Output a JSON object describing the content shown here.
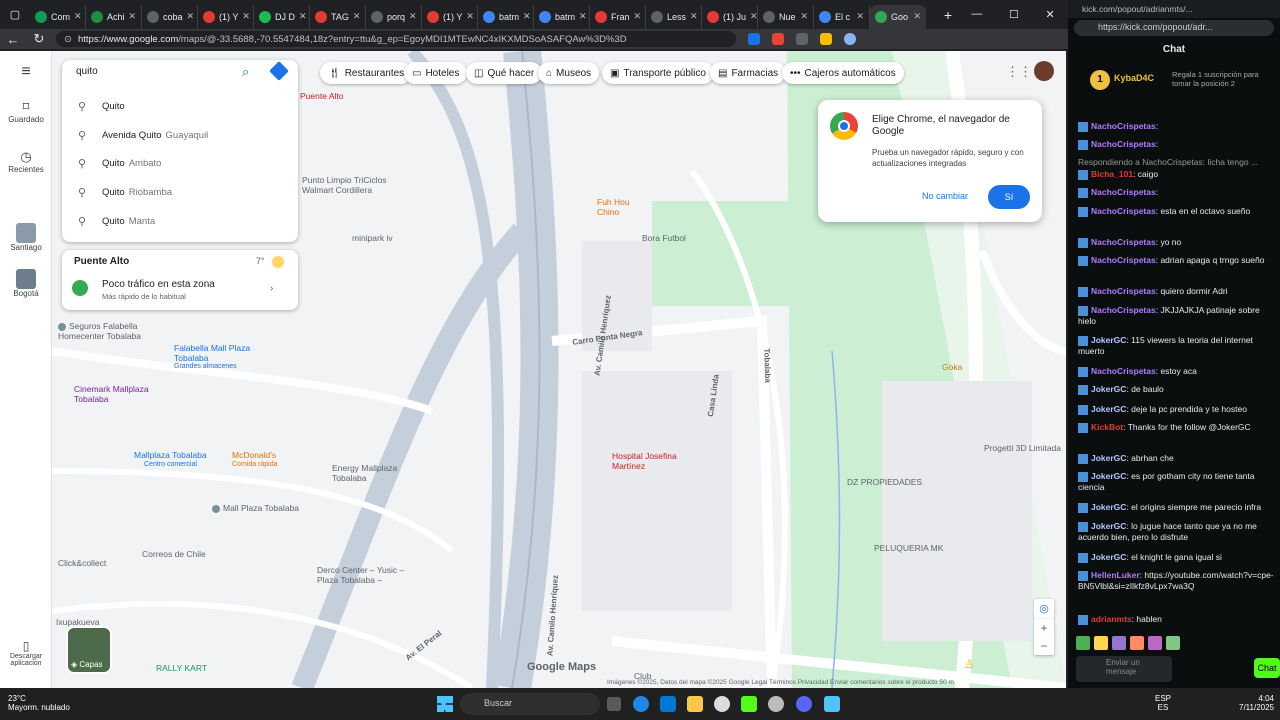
{
  "browser": {
    "tabs": [
      {
        "label": "Com",
        "color": "#0f9d58"
      },
      {
        "label": "Achi",
        "color": "#1e8e3e"
      },
      {
        "label": "coba",
        "color": "#5f6368"
      },
      {
        "label": "(1) Y",
        "color": "#e53935"
      },
      {
        "label": "DJ D",
        "color": "#1db954"
      },
      {
        "label": "TAG",
        "color": "#e53935"
      },
      {
        "label": "porq",
        "color": "#5f6368"
      },
      {
        "label": "(1) Y",
        "color": "#e53935"
      },
      {
        "label": "batm",
        "color": "#4285f4"
      },
      {
        "label": "batm",
        "color": "#4285f4"
      },
      {
        "label": "Fran",
        "color": "#e53935"
      },
      {
        "label": "Less",
        "color": "#5f6368"
      },
      {
        "label": "(1) Ju",
        "color": "#e53935"
      },
      {
        "label": "Nue",
        "color": "#5f6368"
      },
      {
        "label": "El c",
        "color": "#4285f4"
      },
      {
        "label": "Goo",
        "color": "#34a853"
      }
    ],
    "url_host": "https://www.google.com",
    "url_path": "/maps/@-33.5688,-70.5547484,18z?entry=ttu&g_ep=EgoyMDI1MTEwNC4xIKXMDSoASAFQAw%3D%3D"
  },
  "maps": {
    "rail": {
      "menu_icon": "menu-icon",
      "saved": "Guardado",
      "recent": "Recientes",
      "place1": "Santiago",
      "place2": "Bogotá",
      "download": "Descargar aplicación"
    },
    "search": {
      "value": "quito"
    },
    "suggestions": [
      {
        "main": "Quito",
        "sub": ""
      },
      {
        "main": "Avenida Quito",
        "sub": "Guayaquil"
      },
      {
        "main": "Quito",
        "sub": "Ambato"
      },
      {
        "main": "Quito",
        "sub": "Riobamba"
      },
      {
        "main": "Quito",
        "sub": "Manta"
      }
    ],
    "weather": {
      "place": "Puente Alto",
      "temp": "7°",
      "traffic": "Poco tráfico en esta zona",
      "traffic_sub": "Más rápido de lo habitual"
    },
    "chips": [
      "Restaurantes",
      "Hoteles",
      "Qué hacer",
      "Museos",
      "Transporte público",
      "Farmacias",
      "Cajeros automáticos"
    ],
    "popup": {
      "title": "Elige Chrome, el navegador de Google",
      "body": "Prueba un navegador rápido, seguro y con actualizaciones integradas",
      "decline": "No cambiar",
      "accept": "Sí"
    },
    "layers": "Capas",
    "brand": "Google Maps",
    "footer": "Imágenes ©2025, Datos del mapa ©2025 Google   Legal   Términos   Privacidad   Enviar comentarios sobre el producto   50 m",
    "pois": {
      "puente_alto": "Puente Alto",
      "triciclos": "Punto Limpio TriCiclos Walmart Cordillera",
      "minipark": "minipark iv",
      "fuhou": "Fuh Hou",
      "fuhou_sub": "Chino",
      "bora": "Bora Futbol",
      "falabella": "Seguros Falabella Homecenter Tobalaba",
      "falabella_mall": "Falabella Mall Plaza Tobalaba",
      "grandes": "Grandes almacenes",
      "cinemark": "Cinemark Mallplaza Tobalaba",
      "mallplaza": "Mallplaza Tobalaba",
      "centro_comercial": "Centro comercial",
      "mcd": "McDonald's",
      "comida": "Comida rápida",
      "energy": "Energy Mallplaza Tobalaba",
      "mall_plaza": "Mall Plaza Tobalaba",
      "correos": "Correos de Chile",
      "clickcollect": "Click&collect",
      "derco": "Derco Center – Yusic – Plaza Tobalaba –",
      "ixupakueva": "Ixupakueva",
      "rally": "RALLY KART",
      "hospital": "Hospital Josefina Martínez",
      "dz": "DZ PROPIEDADES",
      "peluqueria": "PELUQUERIA MK",
      "progetti": "Progetti 3D Limitada",
      "goka": "Goka",
      "club": "Club"
    },
    "streets": [
      "Av. Camilo Henríquez",
      "Carro Punta Negra",
      "Tobalaba",
      "Av. El Peral",
      "Casa Linda",
      "Av. Camilo Henríquez"
    ]
  },
  "kick": {
    "url": "https://kick.com/popout/adr...",
    "title_url": "kick.com/popout/adrianmts/...",
    "chat_title": "Chat",
    "pinned_user": "KybaD4C",
    "pinned_text": "Regala 1 suscripción para tomar la posición 2",
    "messages": [
      {
        "user": "NachoCrispetas",
        "text": "",
        "color": "#b17cff"
      },
      {
        "user": "NachoCrispetas",
        "text": "",
        "color": "#b17cff"
      },
      {
        "user": "",
        "text": "Respondiendo a NachoCrispetas: licha tengo ...",
        "color": "#999"
      },
      {
        "user": "Bicha_101",
        "text": "caigo",
        "color": "#e53935"
      },
      {
        "user": "NachoCrispetas",
        "text": "",
        "color": "#b17cff"
      },
      {
        "user": "NachoCrispetas",
        "text": "esta en el octavo sueño",
        "color": "#b17cff"
      },
      {
        "user": "NachoCrispetas",
        "text": "yo no",
        "color": "#b17cff"
      },
      {
        "user": "NachoCrispetas",
        "text": "adrian apaga q trngo sueño",
        "color": "#b17cff"
      },
      {
        "user": "NachoCrispetas",
        "text": "quiero dormir Adri",
        "color": "#b17cff"
      },
      {
        "user": "NachoCrispetas",
        "text": "JKJJAJKJA patinaje sobre hielo",
        "color": "#b17cff"
      },
      {
        "user": "JokerGC",
        "text": "115 viewers la teoria del internet muerto",
        "color": "#b4c7ff"
      },
      {
        "user": "NachoCrispetas",
        "text": "estoy aca",
        "color": "#b17cff"
      },
      {
        "user": "JokerGC",
        "text": "de baulo",
        "color": "#b4c7ff"
      },
      {
        "user": "JokerGC",
        "text": "deje la pc prendida y te hosteo",
        "color": "#b4c7ff"
      },
      {
        "user": "KickBot",
        "text": "Thanks for the follow @JokerGC",
        "color": "#e53935"
      },
      {
        "user": "JokerGC",
        "text": "abrhan che",
        "color": "#b4c7ff"
      },
      {
        "user": "JokerGC",
        "text": "es por gotham city no tiene tanta ciencia",
        "color": "#b4c7ff"
      },
      {
        "user": "JokerGC",
        "text": "el origins siempre me parecio infra",
        "color": "#b4c7ff"
      },
      {
        "user": "JokerGC",
        "text": "lo jugue hace tanto que ya no me acuerdo bien, pero lo disfrute",
        "color": "#b4c7ff"
      },
      {
        "user": "JokerGC",
        "text": "el knight le gana igual si",
        "color": "#b4c7ff"
      },
      {
        "user": "HellenLuker",
        "text": "https://youtube.com/watch?v=cpe-BN5Vlbl&si=zIlkfz8vLpx7wa3Q",
        "color": "#b17cff"
      },
      {
        "user": "adrianmts",
        "text": "hablen",
        "color": "#e53935"
      }
    ],
    "input_placeholder": "Enviar un mensaje",
    "send": "Chat"
  },
  "taskbar": {
    "search": "Buscar",
    "weather_temp": "23°C",
    "weather_desc": "Mayorm. nublado",
    "lang": "ESP",
    "lang2": "ES",
    "time": "4:04",
    "date": "7/11/2025"
  }
}
